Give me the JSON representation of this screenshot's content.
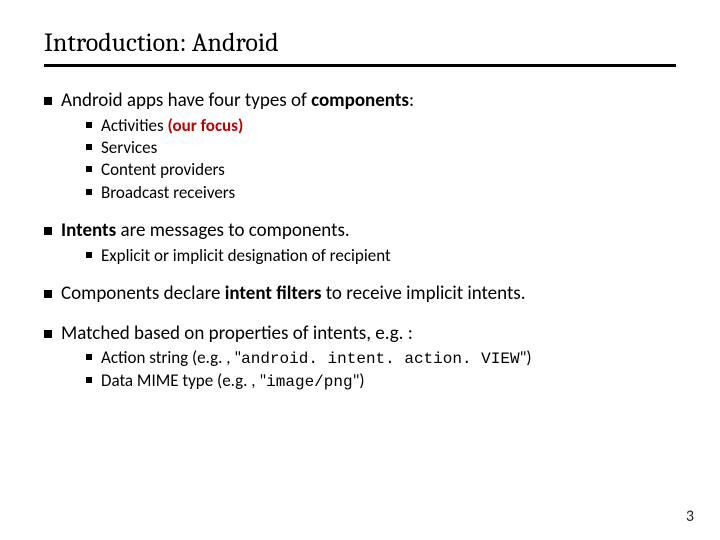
{
  "title": "Introduction: Android",
  "b1": {
    "pre": "Android apps have four types of ",
    "bold": "components",
    "post": ":",
    "sub": {
      "a_pre": "Activities ",
      "a_red": "(our focus)",
      "b": "Services",
      "c": "Content providers",
      "d": "Broadcast receivers"
    }
  },
  "b2": {
    "bold": "Intents",
    "post": " are messages to components.",
    "sub_a": "Explicit or implicit designation of recipient"
  },
  "b3": {
    "pre": "Components declare ",
    "bold": "intent filters",
    "post": " to receive implicit intents."
  },
  "b4": {
    "text": "Matched based on properties of intents, e.g. :",
    "sub": {
      "a_pre": "Action string (e.g. , \"",
      "a_mono": "android. intent. action. VIEW",
      "a_post": "\")",
      "b_pre": "Data MIME type (e.g. , \"",
      "b_mono": "image/png",
      "b_post": "\")"
    }
  },
  "page_number": "3"
}
